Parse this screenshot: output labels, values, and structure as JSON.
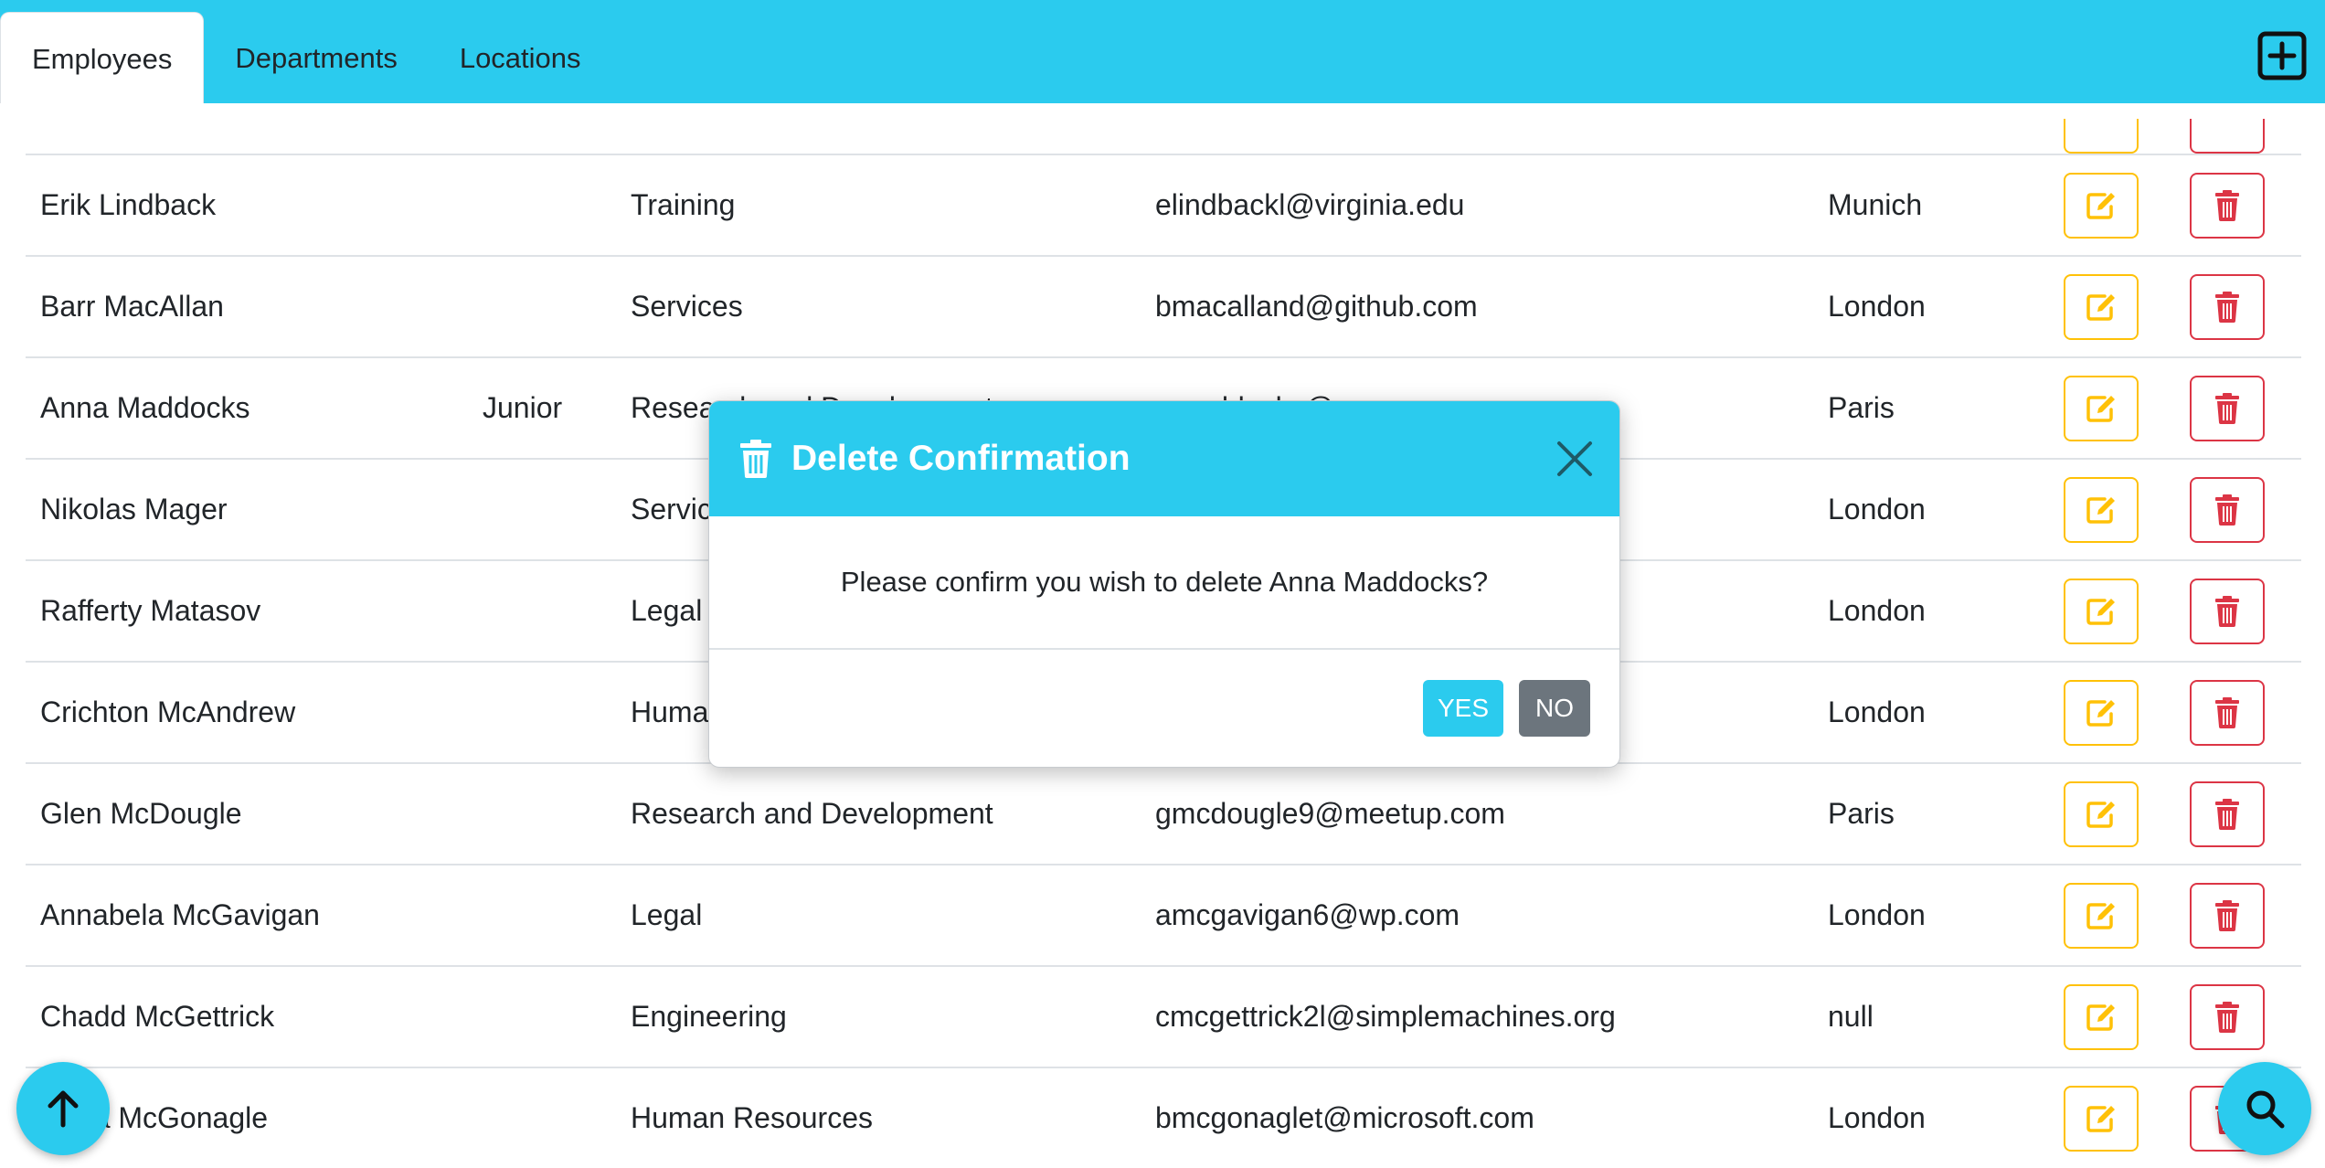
{
  "tabs": [
    {
      "label": "Employees",
      "active": true
    },
    {
      "label": "Departments",
      "active": false
    },
    {
      "label": "Locations",
      "active": false
    }
  ],
  "rows": [
    {
      "name": "Erik Lindback",
      "job": "",
      "department": "Training",
      "email": "elindbackl@virginia.edu",
      "location": "Munich"
    },
    {
      "name": "Barr MacAllan",
      "job": "",
      "department": "Services",
      "email": "bmacalland@github.com",
      "location": "London"
    },
    {
      "name": "Anna Maddocks",
      "job": "Junior",
      "department": "Research and Development",
      "email": "amaddocks@",
      "location": "Paris"
    },
    {
      "name": "Nikolas Mager",
      "job": "",
      "department": "Services",
      "email": "",
      "location": "London"
    },
    {
      "name": "Rafferty Matasov",
      "job": "",
      "department": "Legal",
      "email": "",
      "location": "London"
    },
    {
      "name": "Crichton McAndrew",
      "job": "",
      "department": "Human Resources",
      "email": "",
      "location": "London"
    },
    {
      "name": "Glen McDougle",
      "job": "",
      "department": "Research and Development",
      "email": "gmcdougle9@meetup.com",
      "location": "Paris"
    },
    {
      "name": "Annabela McGavigan",
      "job": "",
      "department": "Legal",
      "email": "amcgavigan6@wp.com",
      "location": "London"
    },
    {
      "name": "Chadd McGettrick",
      "job": "",
      "department": "Engineering",
      "email": "cmcgettrick2l@simplemachines.org",
      "location": "null"
    },
    {
      "name": "Berta McGonagle",
      "job": "",
      "department": "Human Resources",
      "email": "bmcgonaglet@microsoft.com",
      "location": "London"
    }
  ],
  "modal": {
    "title": "Delete Confirmation",
    "message": "Please confirm you wish to delete Anna Maddocks?",
    "yes_label": "YES",
    "no_label": "NO"
  },
  "colors": {
    "primary": "#2bcbee",
    "edit": "#ffc107",
    "delete": "#dc3545",
    "secondary": "#6c757d"
  },
  "icons": {
    "add": "plus-square-icon",
    "edit": "edit-icon",
    "delete": "trash-icon",
    "close": "close-icon",
    "scroll_top": "arrow-up-icon",
    "search": "search-icon"
  }
}
